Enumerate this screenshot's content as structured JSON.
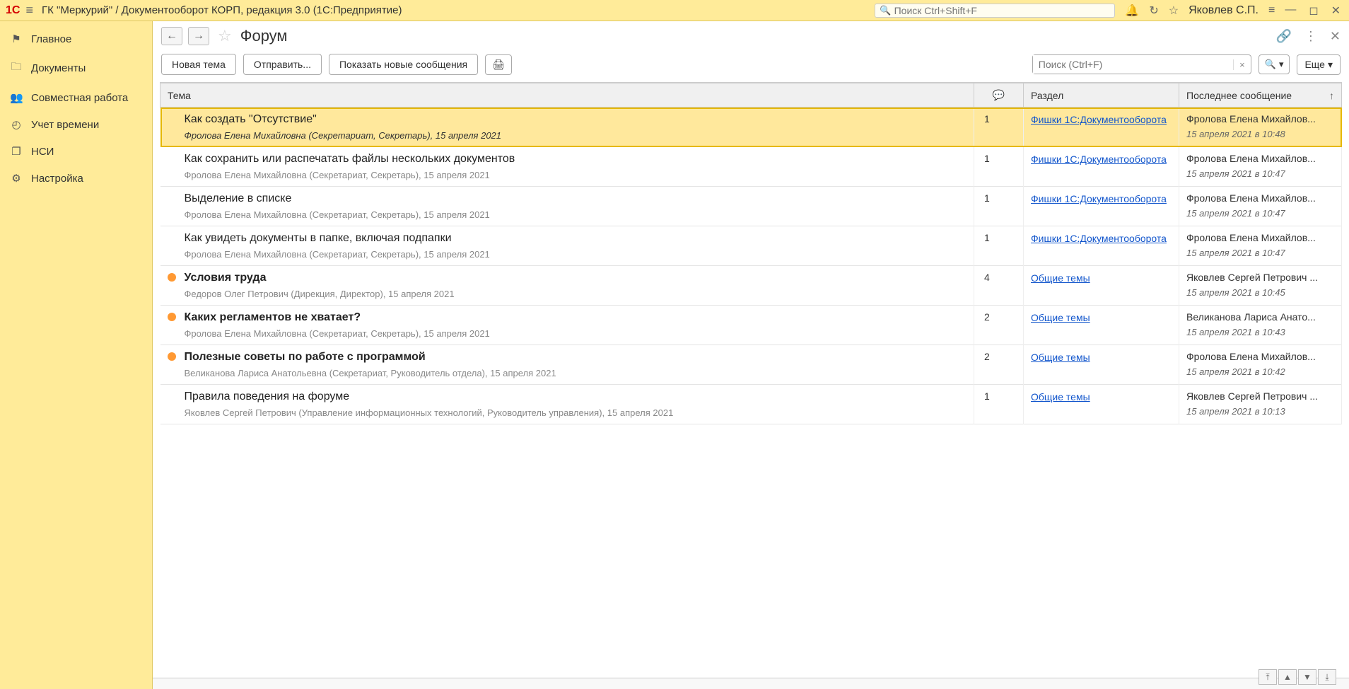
{
  "titlebar": {
    "title": "ГК \"Меркурий\" / Документооборот КОРП, редакция 3.0  (1С:Предприятие)",
    "search_placeholder": "Поиск Ctrl+Shift+F",
    "username": "Яковлев С.П."
  },
  "sidebar": {
    "items": [
      {
        "icon": "⚑",
        "label": "Главное"
      },
      {
        "icon": "🗀",
        "label": "Документы"
      },
      {
        "icon": "👥",
        "label": "Совместная работа"
      },
      {
        "icon": "◴",
        "label": "Учет времени"
      },
      {
        "icon": "❐",
        "label": "НСИ"
      },
      {
        "icon": "⚙",
        "label": "Настройка"
      }
    ]
  },
  "page": {
    "title": "Форум"
  },
  "toolbar": {
    "new_topic": "Новая тема",
    "send": "Отправить...",
    "show_new": "Показать новые сообщения",
    "search_placeholder": "Поиск (Ctrl+F)",
    "more": "Еще"
  },
  "columns": {
    "topic": "Тема",
    "section": "Раздел",
    "last": "Последнее сообщение"
  },
  "rows": [
    {
      "selected": true,
      "unread": false,
      "title": "Как создать \"Отсутствие\"",
      "meta": "Фролова Елена Михайловна (Секретариат, Секретарь), 15 апреля 2021",
      "count": "1",
      "section": "Фишки 1С:Документооборота",
      "last_author": "Фролова Елена Михайлов...",
      "last_date": "15 апреля 2021 в 10:48"
    },
    {
      "selected": false,
      "unread": false,
      "title": "Как сохранить или распечатать файлы нескольких документов",
      "meta": "Фролова Елена Михайловна (Секретариат, Секретарь), 15 апреля 2021",
      "count": "1",
      "section": "Фишки 1С:Документооборота",
      "last_author": "Фролова Елена Михайлов...",
      "last_date": "15 апреля 2021 в 10:47"
    },
    {
      "selected": false,
      "unread": false,
      "title": "Выделение в списке",
      "meta": "Фролова Елена Михайловна (Секретариат, Секретарь), 15 апреля 2021",
      "count": "1",
      "section": "Фишки 1С:Документооборота",
      "last_author": "Фролова Елена Михайлов...",
      "last_date": "15 апреля 2021 в 10:47"
    },
    {
      "selected": false,
      "unread": false,
      "title": "Как увидеть документы в папке, включая подпапки",
      "meta": "Фролова Елена Михайловна (Секретариат, Секретарь), 15 апреля 2021",
      "count": "1",
      "section": "Фишки 1С:Документооборота",
      "last_author": "Фролова Елена Михайлов...",
      "last_date": "15 апреля 2021 в 10:47"
    },
    {
      "selected": false,
      "unread": true,
      "title": "Условия труда",
      "meta": "Федоров Олег Петрович (Дирекция, Директор), 15 апреля 2021",
      "count": "4",
      "section": "Общие темы",
      "last_author": "Яковлев Сергей Петрович ...",
      "last_date": "15 апреля 2021 в 10:45"
    },
    {
      "selected": false,
      "unread": true,
      "title": "Каких регламентов не хватает?",
      "meta": "Фролова Елена Михайловна (Секретариат, Секретарь), 15 апреля 2021",
      "count": "2",
      "section": "Общие темы",
      "last_author": "Великанова Лариса Анато...",
      "last_date": "15 апреля 2021 в 10:43"
    },
    {
      "selected": false,
      "unread": true,
      "title": "Полезные советы по работе с программой",
      "meta": "Великанова Лариса Анатольевна (Секретариат, Руководитель отдела), 15 апреля 2021",
      "count": "2",
      "section": "Общие темы",
      "last_author": "Фролова Елена Михайлов...",
      "last_date": "15 апреля 2021 в 10:42"
    },
    {
      "selected": false,
      "unread": false,
      "title": "Правила поведения на форуме",
      "meta": "Яковлев Сергей Петрович (Управление информационных технологий, Руководитель управления), 15 апреля 2021",
      "count": "1",
      "section": "Общие темы",
      "last_author": "Яковлев Сергей Петрович ...",
      "last_date": "15 апреля 2021 в 10:13"
    }
  ]
}
